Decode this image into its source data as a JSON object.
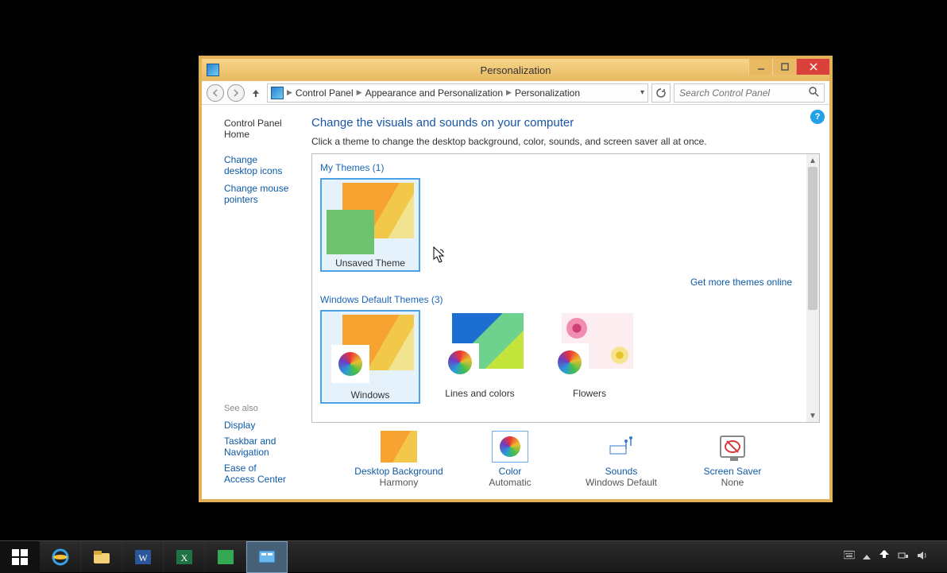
{
  "window": {
    "title": "Personalization",
    "breadcrumbs": [
      "Control Panel",
      "Appearance and Personalization",
      "Personalization"
    ]
  },
  "search": {
    "placeholder": "Search Control Panel"
  },
  "sidebar": {
    "home": "Control Panel Home",
    "tasks": [
      "Change desktop icons",
      "Change mouse pointers"
    ],
    "see_also_header": "See also",
    "see_also": [
      "Display",
      "Taskbar and Navigation",
      "Ease of Access Center"
    ]
  },
  "main": {
    "heading": "Change the visuals and sounds on your computer",
    "subtitle": "Click a theme to change the desktop background, color, sounds, and screen saver all at once."
  },
  "sections": {
    "my_themes": {
      "title": "My Themes (1)"
    },
    "default_themes": {
      "title": "Windows Default Themes (3)"
    },
    "get_more": "Get more themes online"
  },
  "themes": {
    "my": [
      {
        "name": "Unsaved Theme",
        "selected": true
      }
    ],
    "default": [
      {
        "name": "Windows"
      },
      {
        "name": "Lines and colors"
      },
      {
        "name": "Flowers"
      }
    ]
  },
  "settings": {
    "desktop_background": {
      "label": "Desktop Background",
      "value": "Harmony"
    },
    "color": {
      "label": "Color",
      "value": "Automatic"
    },
    "sounds": {
      "label": "Sounds",
      "value": "Windows Default"
    },
    "screen_saver": {
      "label": "Screen Saver",
      "value": "None"
    }
  },
  "tray": {
    "time": ""
  }
}
